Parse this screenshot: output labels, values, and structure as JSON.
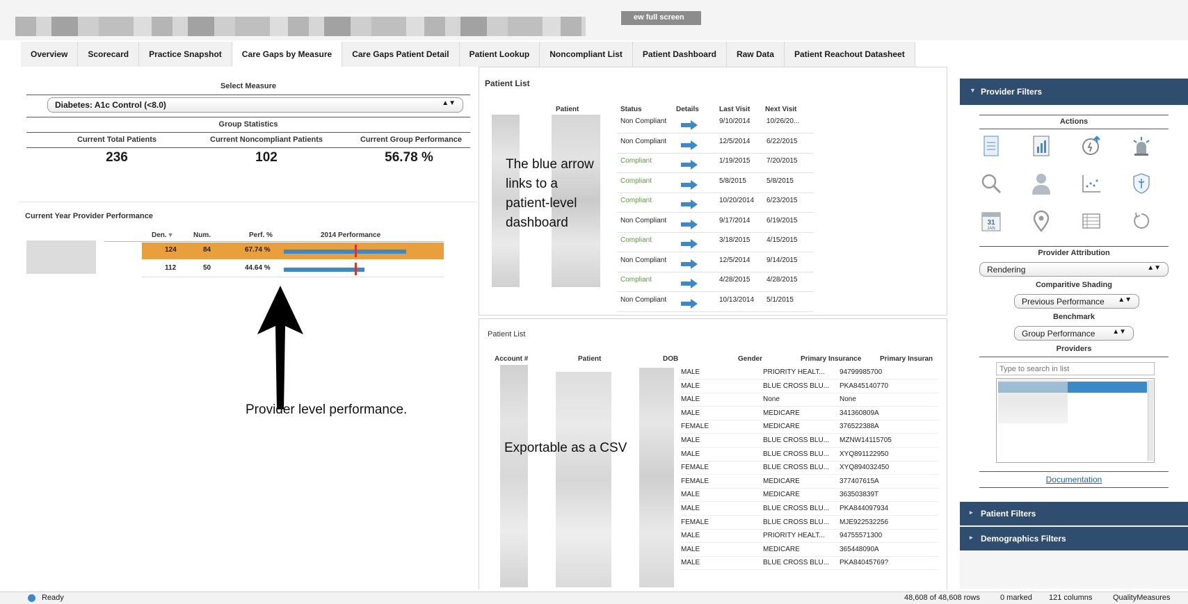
{
  "header": {
    "fullscreen_label": "ew full screen"
  },
  "tabs": [
    "Overview",
    "Scorecard",
    "Practice Snapshot",
    "Care Gaps by Measure",
    "Care Gaps Patient Detail",
    "Patient Lookup",
    "Noncompliant List",
    "Patient Dashboard",
    "Raw Data",
    "Patient Reachout Datasheet"
  ],
  "measure_panel": {
    "select_label": "Select Measure",
    "selected_measure": "Diabetes: A1c Control (<8.0)",
    "group_stats_label": "Group Statistics",
    "stats": [
      {
        "label": "Current Total Patients",
        "value": "236"
      },
      {
        "label": "Current Noncompliant Patients",
        "value": "102"
      },
      {
        "label": "Current Group Performance",
        "value": "56.78 %"
      }
    ]
  },
  "provider_perf": {
    "title": "Current Year Provider Performance",
    "headers": [
      "Den.",
      "Num.",
      "Perf. %",
      "2014 Performance"
    ],
    "sort_indicator": "▾",
    "rows": [
      {
        "den": "124",
        "num": "84",
        "perf": "67.74 %",
        "bar_fraction": 0.6774,
        "highlighted": true
      },
      {
        "den": "112",
        "num": "50",
        "perf": "44.64 %",
        "bar_fraction": 0.4464,
        "highlighted": false
      }
    ],
    "annotation": "Provider level performance."
  },
  "patient_list_top": {
    "title": "Patient List",
    "headers": [
      "Patient",
      "Status",
      "Details",
      "Last Visit",
      "Next Visit"
    ],
    "rows": [
      {
        "status": "Non Compliant",
        "last": "9/10/2014",
        "next": "10/26/20..."
      },
      {
        "status": "Non Compliant",
        "last": "12/5/2014",
        "next": "6/22/2015"
      },
      {
        "status": "Compliant",
        "last": "1/19/2015",
        "next": "7/20/2015"
      },
      {
        "status": "Compliant",
        "last": "5/8/2015",
        "next": "5/8/2015"
      },
      {
        "status": "Compliant",
        "last": "10/20/2014",
        "next": "6/23/2015"
      },
      {
        "status": "Non Compliant",
        "last": "9/17/2014",
        "next": "6/19/2015"
      },
      {
        "status": "Compliant",
        "last": "3/18/2015",
        "next": "4/15/2015"
      },
      {
        "status": "Non Compliant",
        "last": "12/5/2014",
        "next": "9/14/2015"
      },
      {
        "status": "Compliant",
        "last": "4/28/2015",
        "next": "4/28/2015"
      },
      {
        "status": "Non Compliant",
        "last": "10/13/2014",
        "next": "5/1/2015"
      }
    ],
    "annotation_lines": [
      "The blue arrow",
      "links to a",
      "patient-level",
      "dashboard"
    ]
  },
  "patient_list_bottom": {
    "title": "Patient List",
    "headers": [
      "Account #",
      "Patient",
      "DOB",
      "Gender",
      "Primary Insurance",
      "Primary Insuran"
    ],
    "rows": [
      {
        "gender": "MALE",
        "ins": "PRIORITY HEALT...",
        "id": "94799985700"
      },
      {
        "gender": "MALE",
        "ins": "BLUE CROSS BLU...",
        "id": "PKA845140770"
      },
      {
        "gender": "MALE",
        "ins": "None",
        "id": "None"
      },
      {
        "gender": "MALE",
        "ins": "MEDICARE",
        "id": "341360809A"
      },
      {
        "gender": "FEMALE",
        "ins": "MEDICARE",
        "id": "376522388A"
      },
      {
        "gender": "MALE",
        "ins": "BLUE CROSS BLU...",
        "id": "MZNW14115705"
      },
      {
        "gender": "MALE",
        "ins": "BLUE CROSS BLU...",
        "id": "XYQ891122950"
      },
      {
        "gender": "FEMALE",
        "ins": "BLUE CROSS BLU...",
        "id": "XYQ894032450"
      },
      {
        "gender": "FEMALE",
        "ins": "MEDICARE",
        "id": "377407615A"
      },
      {
        "gender": "MALE",
        "ins": "MEDICARE",
        "id": "363503839T"
      },
      {
        "gender": "MALE",
        "ins": "BLUE CROSS BLU...",
        "id": "PKA844097934"
      },
      {
        "gender": "FEMALE",
        "ins": "BLUE CROSS BLU...",
        "id": "MJE922532256"
      },
      {
        "gender": "MALE",
        "ins": "PRIORITY HEALT...",
        "id": "94755571300"
      },
      {
        "gender": "MALE",
        "ins": "MEDICARE",
        "id": "365448090A"
      },
      {
        "gender": "MALE",
        "ins": "BLUE CROSS BLU...",
        "id": "PKA84045769?"
      }
    ],
    "annotation": "Exportable as a CSV"
  },
  "sidebar": {
    "provider_filters": "Provider Filters",
    "actions_label": "Actions",
    "icons": [
      "document-icon",
      "report-icon",
      "refresh-alert-icon",
      "alarm-icon",
      "search-icon",
      "person-icon",
      "scatter-chart-icon",
      "shield-icon",
      "calendar-icon",
      "location-pin-icon",
      "table-icon",
      "reset-icon"
    ],
    "calendar_day": "31",
    "calendar_month": "JAN",
    "provider_attribution_label": "Provider Attribution",
    "provider_attribution_value": "Rendering",
    "comparative_shading_label": "Comparitive Shading",
    "comparative_shading_value": "Previous Performance",
    "benchmark_label": "Benchmark",
    "benchmark_value": "Group Performance",
    "providers_label": "Providers",
    "search_placeholder": "Type to search in list",
    "documentation_link": "Documentation",
    "patient_filters": "Patient Filters",
    "demographics_filters": "Demographics Filters"
  },
  "statusbar": {
    "ready": "Ready",
    "rows": "48,608 of 48,608 rows",
    "marked": "0 marked",
    "columns": "121 columns",
    "app": "QualityMeasures"
  },
  "colors": {
    "accent_blue": "#3a89c9",
    "highlight_orange": "#e9a03c",
    "compliant_green": "#5a9a3a",
    "sidebar_header": "#2f4e6f",
    "benchmark_red": "#d9342b"
  }
}
